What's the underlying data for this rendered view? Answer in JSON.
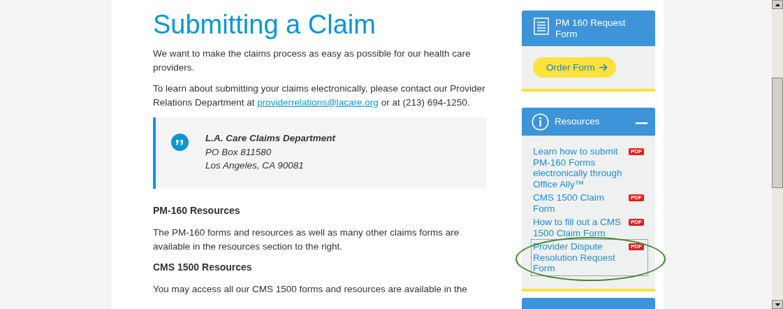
{
  "title": "Submitting a Claim",
  "intro": "We want to make the claims process as easy as possible for our health care providers.",
  "contact": {
    "before": "To learn about submitting your claims electronically, please contact our Provider Relations Department at ",
    "email": "providerrelations@lacare.org",
    "after": " or at (213) 694-1250."
  },
  "address": {
    "name": "L.A. Care Claims Department",
    "lines": [
      "PO Box 811580",
      "Los Angeles, CA 90081"
    ]
  },
  "sections": [
    {
      "heading": "PM-160 Resources",
      "text": "The PM-160 forms and resources as well as many other claims forms are available in the resources section to the right."
    },
    {
      "heading": "CMS 1500 Resources",
      "text": "You may access all our CMS 1500 forms and resources are available in the"
    }
  ],
  "sidebar": {
    "request_card": {
      "title": "PM 160 Request Form",
      "button": "Order Form"
    },
    "resources_card": {
      "title": "Resources",
      "expanded": true,
      "links": [
        {
          "label": "Learn how to submit PM-160 Forms electronically through Office Ally™",
          "badge": "PDF",
          "focused": false,
          "circled": false
        },
        {
          "label": "CMS 1500 Claim Form",
          "badge": "PDF",
          "focused": false,
          "circled": false
        },
        {
          "label": "How to fill out a CMS 1500 Claim Form",
          "badge": "PDF",
          "focused": false,
          "circled": false
        },
        {
          "label": "Provider Dispute Resolution Request Form",
          "badge": "PDF",
          "focused": true,
          "circled": true
        }
      ]
    }
  }
}
